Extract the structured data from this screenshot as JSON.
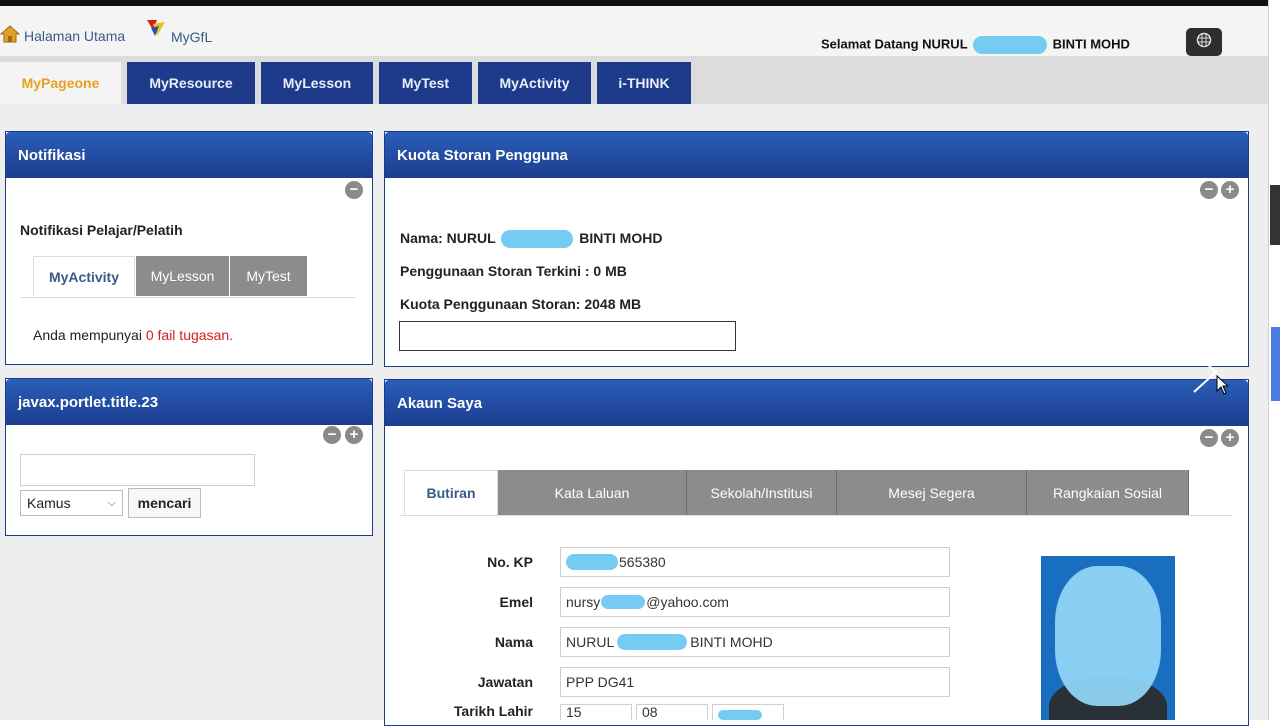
{
  "header": {
    "home_label": "Halaman Utama",
    "mygfl_label": "MyGfL",
    "welcome_prefix": "Selamat Datang NURUL",
    "welcome_suffix": "BINTI MOHD"
  },
  "tabs": [
    "MyPageone",
    "MyResource",
    "MyLesson",
    "MyTest",
    "MyActivity",
    "i-THINK"
  ],
  "notifikasi": {
    "title": "Notifikasi",
    "subtitle": "Notifikasi Pelajar/Pelatih",
    "subtabs": [
      "MyActivity",
      "MyLesson",
      "MyTest"
    ],
    "message_prefix": "Anda mempunyai",
    "message_highlight": "0 fail tugasan."
  },
  "kamus": {
    "title": "javax.portlet.title.23",
    "select_value": "Kamus",
    "button_label": "mencari"
  },
  "kuota": {
    "title": "Kuota Storan Pengguna",
    "name_prefix": "Nama: NURUL",
    "name_suffix": "BINTI MOHD",
    "usage_line": "Penggunaan Storan Terkini : 0 MB",
    "quota_line": "Kuota Penggunaan Storan: 2048 MB",
    "usage_fraction": 0
  },
  "akaun": {
    "title": "Akaun Saya",
    "tabs": [
      "Butiran",
      "Kata Laluan",
      "Sekolah/Institusi",
      "Mesej Segera",
      "Rangkaian Sosial"
    ],
    "fields": {
      "kp_label": "No. KP",
      "kp_value": "565380",
      "emel_label": "Emel",
      "emel_prefix": "nursy",
      "emel_suffix": "@yahoo.com",
      "nama_label": "Nama",
      "nama_prefix": "NURUL",
      "nama_suffix": "BINTI MOHD",
      "jawatan_label": "Jawatan",
      "jawatan_value": "PPP DG41",
      "lahir_label": "Tarikh Lahir",
      "lahir_day": "15",
      "lahir_month": "08"
    }
  },
  "colors": {
    "navy": "#1e3a8a",
    "active_tab_text": "#e8a020",
    "highlight_red": "#d02020",
    "redact_blue": "#6fc8f2"
  }
}
